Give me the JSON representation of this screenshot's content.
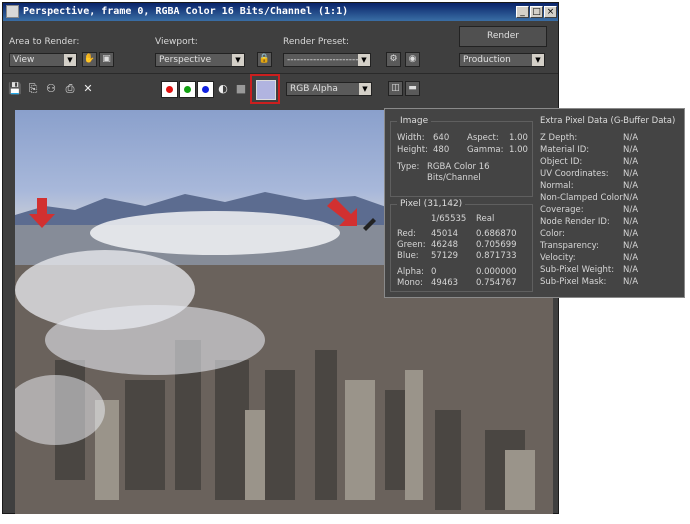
{
  "window": {
    "title": "Perspective, frame 0, RGBA Color 16 Bits/Channel (1:1)",
    "min_label": "_",
    "max_label": "□",
    "close_label": "×"
  },
  "controls": {
    "area_label": "Area to Render:",
    "area_value": "View",
    "viewport_label": "Viewport:",
    "viewport_value": "Perspective",
    "preset_label": "Render Preset:",
    "preset_value": "------------------------",
    "render_button": "Render",
    "production_value": "Production",
    "channel_value": "RGB Alpha",
    "accent": "#cc1f1f"
  },
  "image_info": {
    "section": "Image",
    "width_label": "Width:",
    "width_value": "640",
    "height_label": "Height:",
    "height_value": "480",
    "aspect_label": "Aspect:",
    "aspect_value": "1.00",
    "gamma_label": "Gamma:",
    "gamma_value": "1.00",
    "type_label": "Type:",
    "type_value_1": "RGBA Color 16",
    "type_value_2": "Bits/Channel"
  },
  "pixel_info": {
    "section": "Pixel (31,142)",
    "col1": "1/65535",
    "col2": "Real",
    "rows": [
      {
        "label": "Red:",
        "a": "45014",
        "b": "0.686870"
      },
      {
        "label": "Green:",
        "a": "46248",
        "b": "0.705699"
      },
      {
        "label": "Blue:",
        "a": "57129",
        "b": "0.871733"
      },
      {
        "label": "Alpha:",
        "a": "0",
        "b": "0.000000"
      },
      {
        "label": "Mono:",
        "a": "49463",
        "b": "0.754767"
      }
    ]
  },
  "gbuffer": {
    "section": "Extra Pixel Data (G-Buffer Data)",
    "rows": [
      {
        "label": "Z Depth:",
        "value": "N/A"
      },
      {
        "label": "Material ID:",
        "value": "N/A"
      },
      {
        "label": "Object ID:",
        "value": "N/A"
      },
      {
        "label": "UV Coordinates:",
        "value": "N/A"
      },
      {
        "label": "Normal:",
        "value": "N/A"
      },
      {
        "label": "Non-Clamped Color:",
        "value": "N/A"
      },
      {
        "label": "Coverage:",
        "value": "N/A"
      },
      {
        "label": "Node Render ID:",
        "value": "N/A"
      },
      {
        "label": "Color:",
        "value": "N/A"
      },
      {
        "label": "Transparency:",
        "value": "N/A"
      },
      {
        "label": "Velocity:",
        "value": "N/A"
      },
      {
        "label": "Sub-Pixel Weight:",
        "value": "N/A"
      },
      {
        "label": "Sub-Pixel Mask:",
        "value": "N/A"
      }
    ]
  }
}
